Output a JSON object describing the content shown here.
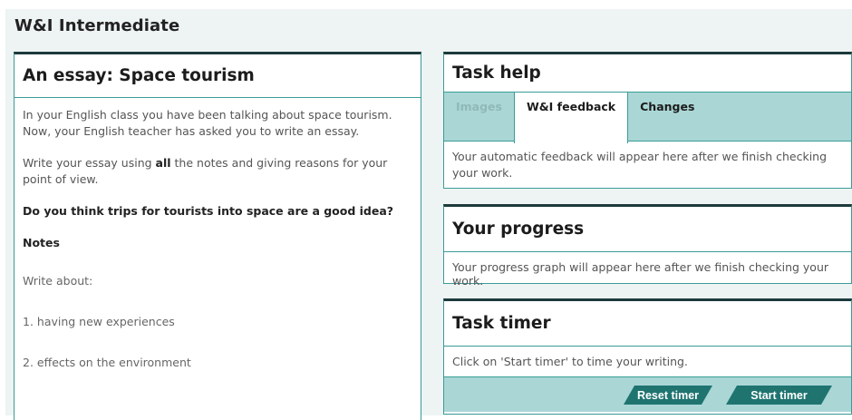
{
  "app": {
    "title": "W&I Intermediate"
  },
  "essay": {
    "title": "An essay: Space tourism",
    "intro": "In your English class you have been talking about space tourism. Now, your English teacher has asked you to write an essay.",
    "instruction_before": "Write your essay using ",
    "instruction_bold": "all",
    "instruction_after": " the notes and giving reasons for your point of view.",
    "question": "Do you think trips for tourists into space are a good idea?",
    "notes_heading": "Notes",
    "write_about": "Write about:",
    "notes": [
      "1. having new experiences",
      "2. effects on the environment"
    ]
  },
  "task_help": {
    "title": "Task help",
    "tabs": [
      {
        "label": "Images",
        "state": "disabled"
      },
      {
        "label": "W&I feedback",
        "state": "active"
      },
      {
        "label": "Changes",
        "state": "normal"
      }
    ],
    "message": "Your automatic feedback will appear here after we finish checking your work."
  },
  "progress": {
    "title": "Your progress",
    "message": "Your progress graph will appear here after we finish checking your work."
  },
  "timer": {
    "title": "Task timer",
    "message": "Click on 'Start timer' to time your writing.",
    "reset_label": "Reset timer",
    "start_label": "Start timer"
  },
  "colors": {
    "accent_dark": "#1f7470",
    "accent_light": "#aad7d6",
    "border": "#3a9c97",
    "card_top": "#1d3a3c",
    "background": "#eef3f3"
  }
}
